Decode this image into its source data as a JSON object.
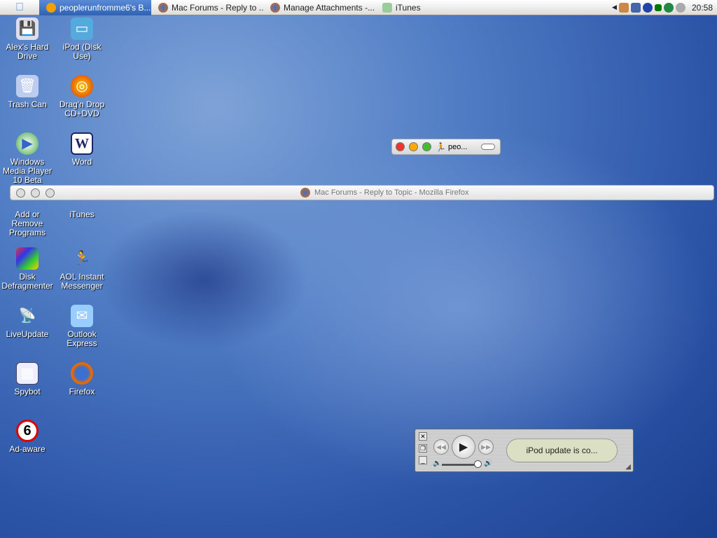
{
  "taskbar": {
    "tasks": [
      {
        "label": "peoplerunfromme6's B...",
        "active": true
      },
      {
        "label": "Mac Forums - Reply to ..."
      },
      {
        "label": "Manage Attachments -..."
      },
      {
        "label": "iTunes"
      }
    ],
    "clock": "20:58"
  },
  "desktop_icons": [
    {
      "label": "Alex's Hard Drive"
    },
    {
      "label": "iPod (Disk Use)"
    },
    {
      "label": "Trash Can"
    },
    {
      "label": "Drag'n Drop CD+DVD"
    },
    {
      "label": "Windows Media Player 10 Beta"
    },
    {
      "label": "Word"
    },
    {
      "label": "Add or Remove Programs"
    },
    {
      "label": "iTunes"
    },
    {
      "label": "Disk Defragmenter"
    },
    {
      "label": "AOL Instant Messenger"
    },
    {
      "label": "LiveUpdate"
    },
    {
      "label": "Outlook Express"
    },
    {
      "label": "Spybot"
    },
    {
      "label": "Firefox"
    },
    {
      "label": "Ad-aware"
    }
  ],
  "aim_window": {
    "title": "peo..."
  },
  "firefox_window": {
    "title": "Mac Forums - Reply to Topic - Mozilla Firefox"
  },
  "itunes_player": {
    "status": "iPod update is co..."
  }
}
